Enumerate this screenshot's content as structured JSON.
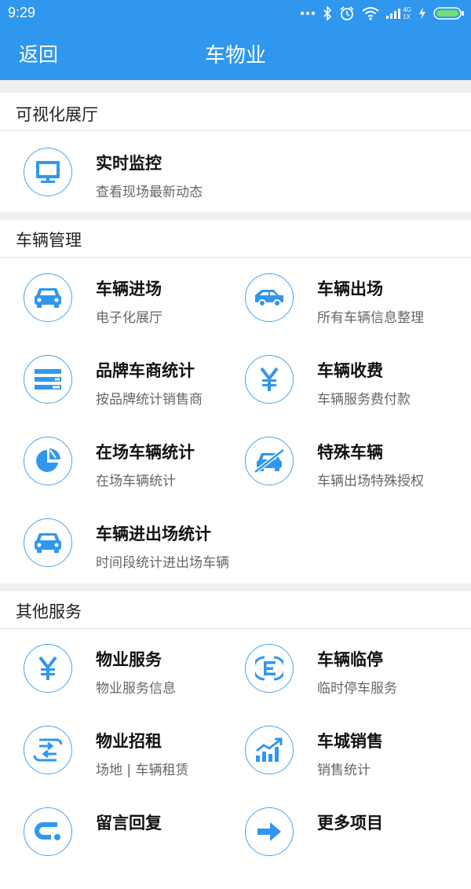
{
  "status_bar": {
    "time": "9:29",
    "net_a": "4G",
    "net_b": "1X"
  },
  "header": {
    "back_label": "返回",
    "title": "车物业"
  },
  "sections": {
    "visual": {
      "title": "可视化展厅",
      "items": [
        {
          "name": "实时监控",
          "desc": "查看现场最新动态",
          "icon": "monitor-icon"
        }
      ]
    },
    "vehicle": {
      "title": "车辆管理",
      "items": [
        {
          "name": "车辆进场",
          "desc": "电子化展厅",
          "icon": "car-front-icon"
        },
        {
          "name": "车辆出场",
          "desc": "所有车辆信息整理",
          "icon": "car-side-icon"
        },
        {
          "name": "品牌车商统计",
          "desc": "按品牌统计销售商",
          "icon": "bars-list-icon"
        },
        {
          "name": "车辆收费",
          "desc": "车辆服务费付款",
          "icon": "yen-icon"
        },
        {
          "name": "在场车辆统计",
          "desc": "在场车辆统计",
          "icon": "pie-chart-icon"
        },
        {
          "name": "特殊车辆",
          "desc": "车辆出场特殊授权",
          "icon": "car-crossed-icon"
        },
        {
          "name": "车辆进出场统计",
          "desc": "时间段统计进出场车辆",
          "icon": "car-front-icon"
        }
      ]
    },
    "other": {
      "title": "其他服务",
      "items": [
        {
          "name": "物业服务",
          "desc": "物业服务信息",
          "icon": "yen-icon"
        },
        {
          "name": "车辆临停",
          "desc": "临时停车服务",
          "icon": "parking-e-icon"
        },
        {
          "name": "物业招租",
          "desc": "场地 | 车辆租赁",
          "icon": "exchange-icon"
        },
        {
          "name": "车城销售",
          "desc": "销售统计",
          "icon": "growth-chart-icon"
        },
        {
          "name": "留言回复",
          "desc": "",
          "icon": "reply-icon"
        },
        {
          "name": "更多项目",
          "desc": "",
          "icon": "arrow-right-icon"
        }
      ]
    }
  },
  "colors": {
    "primary": "#2f97ee",
    "icon_blue": "#2f97ee",
    "section_gap": "#efefef"
  }
}
